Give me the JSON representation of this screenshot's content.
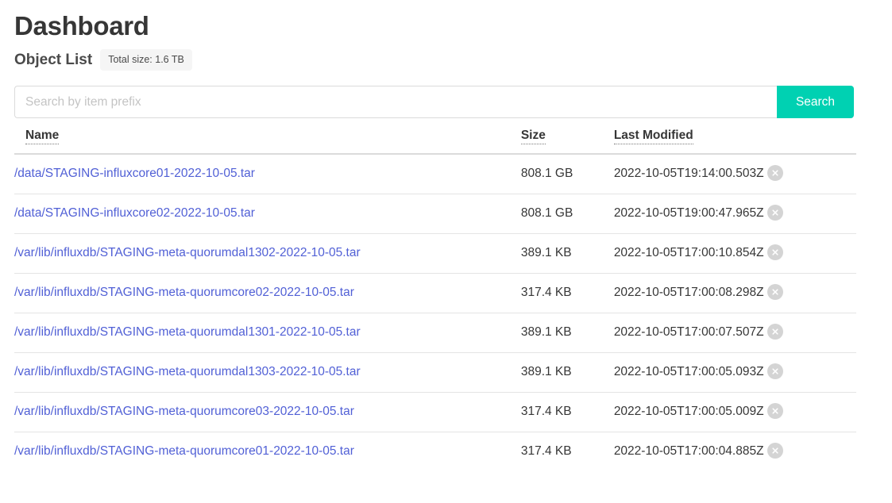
{
  "header": {
    "title": "Dashboard",
    "subtitle": "Object List",
    "total_size_badge": "Total size: 1.6 TB"
  },
  "search": {
    "placeholder": "Search by item prefix",
    "value": "",
    "button_label": "Search"
  },
  "table": {
    "columns": {
      "name": "Name",
      "size": "Size",
      "last_modified": "Last Modified"
    },
    "rows": [
      {
        "name": "/data/STAGING-influxcore01-2022-10-05.tar",
        "size": "808.1 GB",
        "last_modified": "2022-10-05T19:14:00.503Z",
        "delete_icon": "close-circle-icon"
      },
      {
        "name": "/data/STAGING-influxcore02-2022-10-05.tar",
        "size": "808.1 GB",
        "last_modified": "2022-10-05T19:00:47.965Z",
        "delete_icon": "close-circle-icon"
      },
      {
        "name": "/var/lib/influxdb/STAGING-meta-quorumdal1302-2022-10-05.tar",
        "size": "389.1 KB",
        "last_modified": "2022-10-05T17:00:10.854Z",
        "delete_icon": "close-circle-icon"
      },
      {
        "name": "/var/lib/influxdb/STAGING-meta-quorumcore02-2022-10-05.tar",
        "size": "317.4 KB",
        "last_modified": "2022-10-05T17:00:08.298Z",
        "delete_icon": "close-circle-icon"
      },
      {
        "name": "/var/lib/influxdb/STAGING-meta-quorumdal1301-2022-10-05.tar",
        "size": "389.1 KB",
        "last_modified": "2022-10-05T17:00:07.507Z",
        "delete_icon": "close-circle-icon"
      },
      {
        "name": "/var/lib/influxdb/STAGING-meta-quorumdal1303-2022-10-05.tar",
        "size": "389.1 KB",
        "last_modified": "2022-10-05T17:00:05.093Z",
        "delete_icon": "close-circle-icon"
      },
      {
        "name": "/var/lib/influxdb/STAGING-meta-quorumcore03-2022-10-05.tar",
        "size": "317.4 KB",
        "last_modified": "2022-10-05T17:00:05.009Z",
        "delete_icon": "close-circle-icon"
      },
      {
        "name": "/var/lib/influxdb/STAGING-meta-quorumcore01-2022-10-05.tar",
        "size": "317.4 KB",
        "last_modified": "2022-10-05T17:00:04.885Z",
        "delete_icon": "close-circle-icon"
      }
    ]
  },
  "colors": {
    "primary": "#00d1b2",
    "link": "#5160d6",
    "text": "#363636",
    "badge_bg": "#f5f5f5",
    "border": "#dbdbdb",
    "delete_icon_bg": "#d4d4d4"
  }
}
